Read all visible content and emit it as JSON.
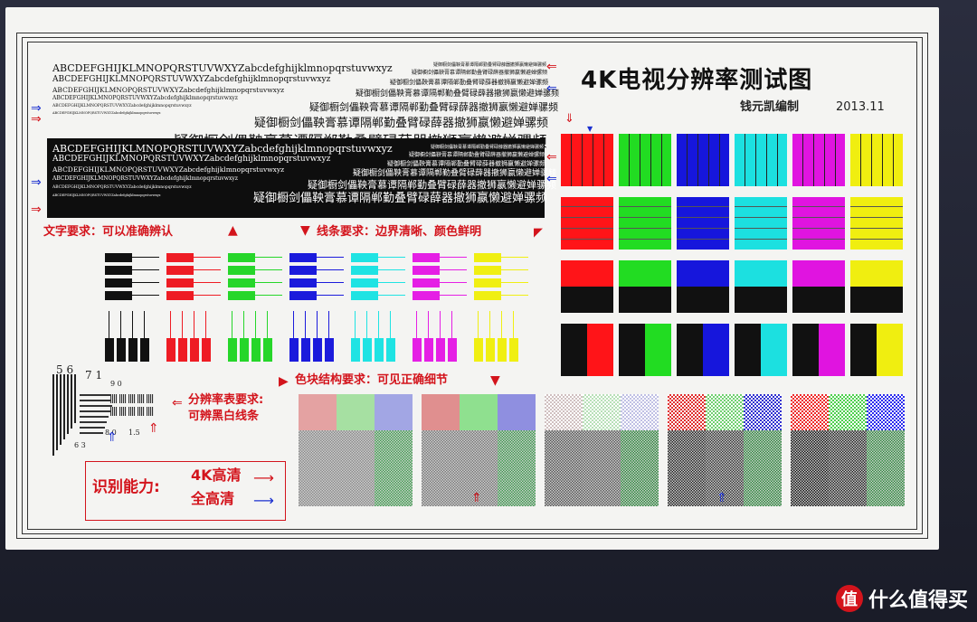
{
  "title": "4K电视分辨率测试图",
  "author": "钱元凯编制",
  "date": "2013.11",
  "alphabet_line": "ABCDEFGHIJKLMNOPQRSTUVWXYZabcdefghijklmnopqrstuvwxyz",
  "chinese_line": "疑御橱剑儡鞅膏慕谭隔郸勤叠臂碌薛器撤狮嬴懒避婵骡频",
  "label_text": "文字要求：可以准确辨认",
  "label_lines": "线条要求：边界清晰、颜色鲜明",
  "label_color_blocks": "色块结构要求：可见正确细节",
  "label_resolution_1": "分辨率表要求:",
  "label_resolution_2": "可辨黑白线条",
  "recognition_label": "识别能力:",
  "recognition_4k": "4K高清",
  "recognition_fhd": "全高清",
  "wedge_numbers": [
    "5 6",
    "7 1",
    "9 0",
    "8 0",
    "6 3",
    "1.5"
  ],
  "bar_colors": [
    "#111111",
    "#ee1c24",
    "#26d62a",
    "#1b1bdc",
    "#1fe3e3",
    "#e51fe5",
    "#f0ef12"
  ],
  "grid_colors": [
    "#ff1418",
    "#22dc22",
    "#1616dc",
    "#1ce0e0",
    "#e014e0",
    "#f0ee10"
  ],
  "logo_text": "什么值得买",
  "logo_badge": "值"
}
